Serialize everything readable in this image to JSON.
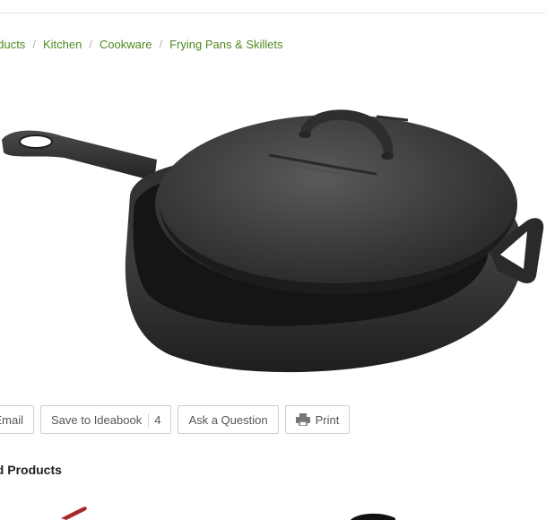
{
  "breadcrumb": [
    {
      "label": "oducts"
    },
    {
      "label": "Kitchen"
    },
    {
      "label": "Cookware"
    },
    {
      "label": "Frying Pans & Skillets"
    }
  ],
  "breadcrumb_separator": "/",
  "product_image": {
    "icon": "cast-iron-skillet-with-lid"
  },
  "actions": {
    "email_label": "Email",
    "save_label": "Save to Ideabook",
    "save_count": "4",
    "ask_label": "Ask a Question",
    "print_label": "Print"
  },
  "related": {
    "title": "ed Products"
  },
  "colors": {
    "link_green": "#4e8a1f",
    "border": "#cfcfcf"
  }
}
